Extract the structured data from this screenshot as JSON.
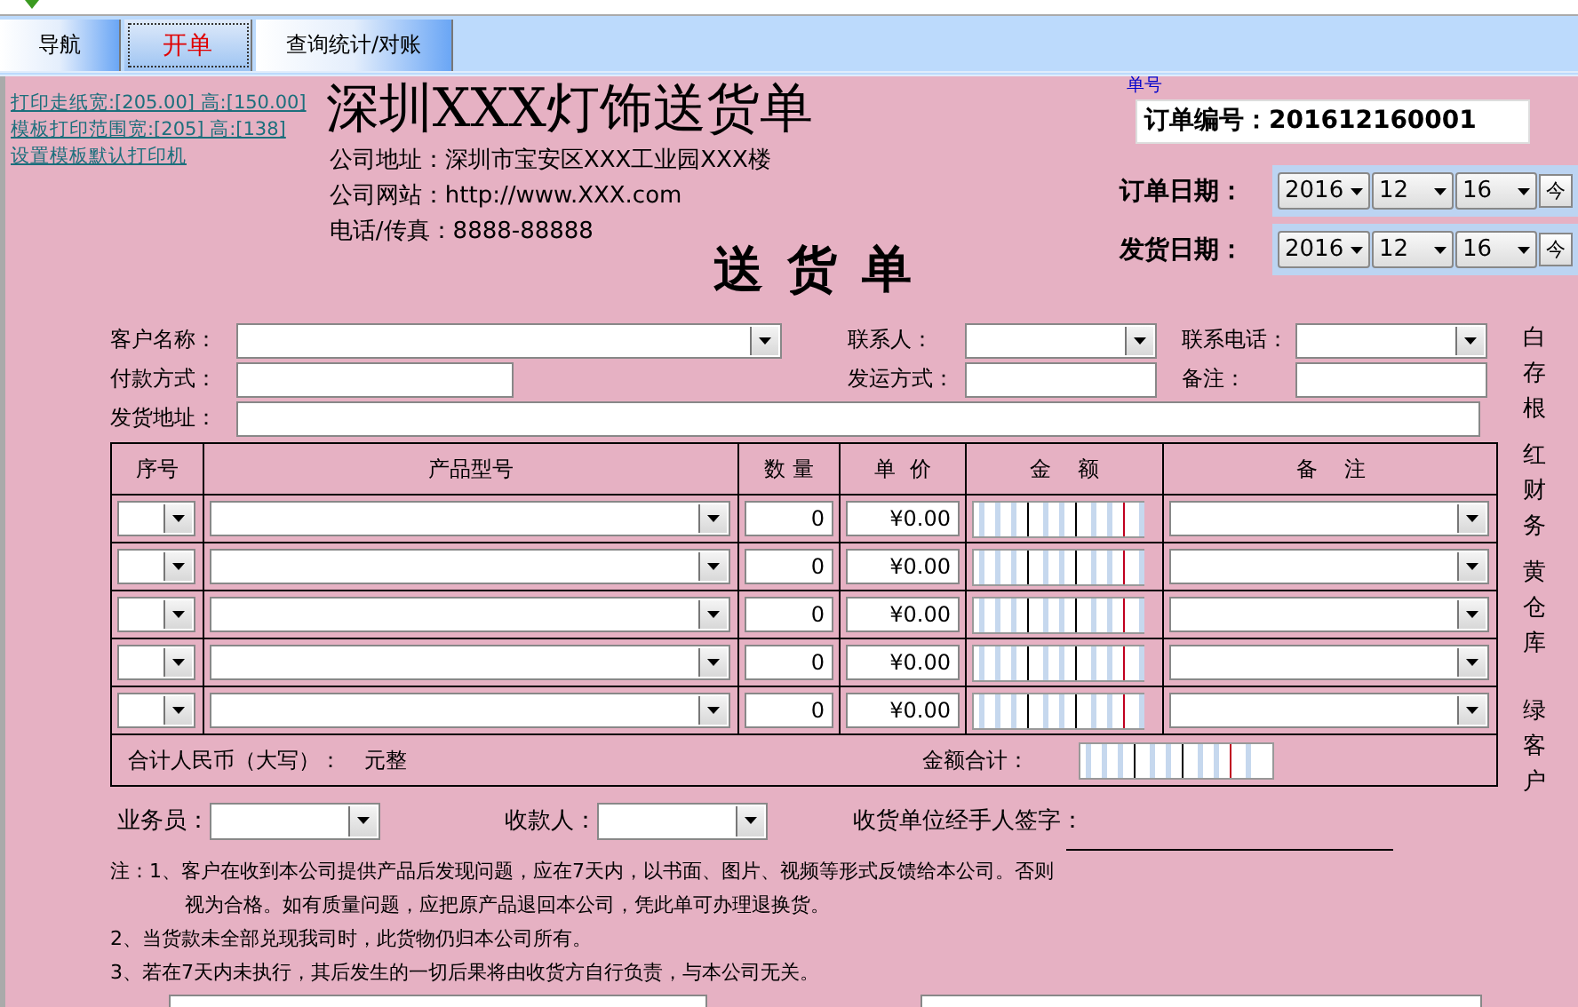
{
  "tabs": [
    {
      "label": "导航",
      "selected": false
    },
    {
      "label": "开单",
      "selected": true
    },
    {
      "label": "查询统计/对账",
      "selected": false
    }
  ],
  "print_links": [
    "打印走纸宽:[205.00] 高:[150.00]",
    "模板打印范围宽:[205] 高:[138]",
    "设置模板默认打印机"
  ],
  "company": {
    "name": "深圳XXX灯饰送货单",
    "lines": [
      "公司地址：深圳市宝安区XXX工业园XXX楼",
      "公司网站：http://www.XXX.com",
      "电话/传真：8888-88888"
    ]
  },
  "doc_title": "送 货 单",
  "order": {
    "caption": "单号",
    "number": "订单编号：201612160001"
  },
  "dates": [
    {
      "label": "订单日期：",
      "year": "2016",
      "month": "12",
      "day": "16",
      "today": "今"
    },
    {
      "label": "发货日期：",
      "year": "2016",
      "month": "12",
      "day": "16",
      "today": "今"
    }
  ],
  "field_rows": [
    [
      {
        "label": "客户名称：",
        "kind": "combo"
      },
      {
        "label": "联系人：",
        "kind": "combo"
      },
      {
        "label": "联系电话：",
        "kind": "combo"
      }
    ],
    [
      {
        "label": "付款方式：",
        "kind": "text"
      },
      {
        "label": "发运方式：",
        "kind": "text"
      },
      {
        "label": "备注：",
        "kind": "text"
      }
    ],
    [
      {
        "label": "发货地址：",
        "kind": "long_text"
      }
    ]
  ],
  "table": {
    "columns": [
      "序号",
      "产品型号",
      "数 量",
      "单  价",
      "金    额",
      "备    注"
    ],
    "rows": [
      {
        "quantity": "0",
        "price": "¥0.00"
      },
      {
        "quantity": "0",
        "price": "¥0.00"
      },
      {
        "quantity": "0",
        "price": "¥0.00"
      },
      {
        "quantity": "0",
        "price": "¥0.00"
      },
      {
        "quantity": "0",
        "price": "¥0.00"
      }
    ],
    "total_words_label": "合计人民币（大写）：",
    "total_words_unit": "元整",
    "total_amount_label": "金额合计："
  },
  "copies": [
    "白存根",
    "红财务",
    "黄仓库",
    "绿客户"
  ],
  "people": [
    {
      "label": "业务员："
    },
    {
      "label": "收款人："
    }
  ],
  "signature": "收货单位经手人签字：",
  "notes": [
    "注：1、客户在收到本公司提供产品后发现问题，应在7天内，以书面、图片、视频等形式反馈给本公司。否则",
    "视为合格。如有质量问题，应把原产品退回本公司，凭此单可办理退换货。",
    "2、当货款未全部兑现我司时，此货物仍归本公司所有。",
    "3、若在7天内未执行，其后发生的一切后果将由收货方自行负责，与本公司无关。"
  ]
}
